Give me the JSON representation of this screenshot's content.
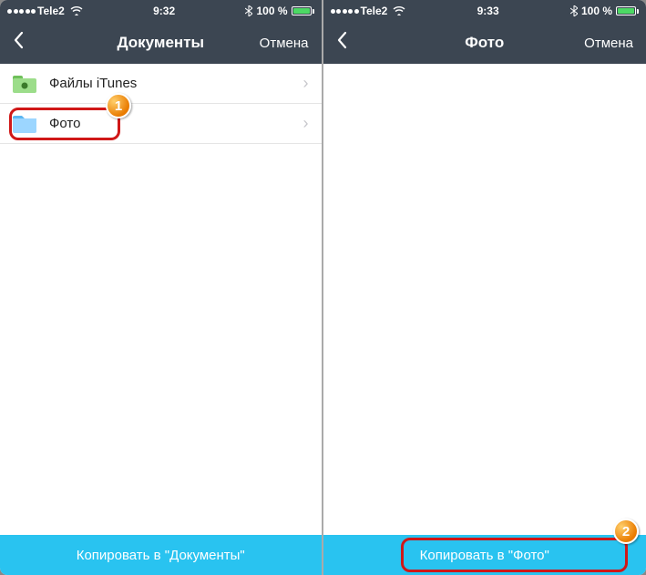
{
  "left": {
    "statusbar": {
      "carrier": "Tele2",
      "time": "9:32",
      "battery_text": "100 %"
    },
    "nav": {
      "title": "Документы",
      "cancel": "Отмена"
    },
    "rows": [
      {
        "label": "Файлы iTunes",
        "icon": "folder-green"
      },
      {
        "label": "Фото",
        "icon": "folder-blue"
      }
    ],
    "copybar": "Копировать в \"Документы\"",
    "badge": "1"
  },
  "right": {
    "statusbar": {
      "carrier": "Tele2",
      "time": "9:33",
      "battery_text": "100 %"
    },
    "nav": {
      "title": "Фото",
      "cancel": "Отмена"
    },
    "copybar": "Копировать в \"Фото\"",
    "badge": "2"
  }
}
